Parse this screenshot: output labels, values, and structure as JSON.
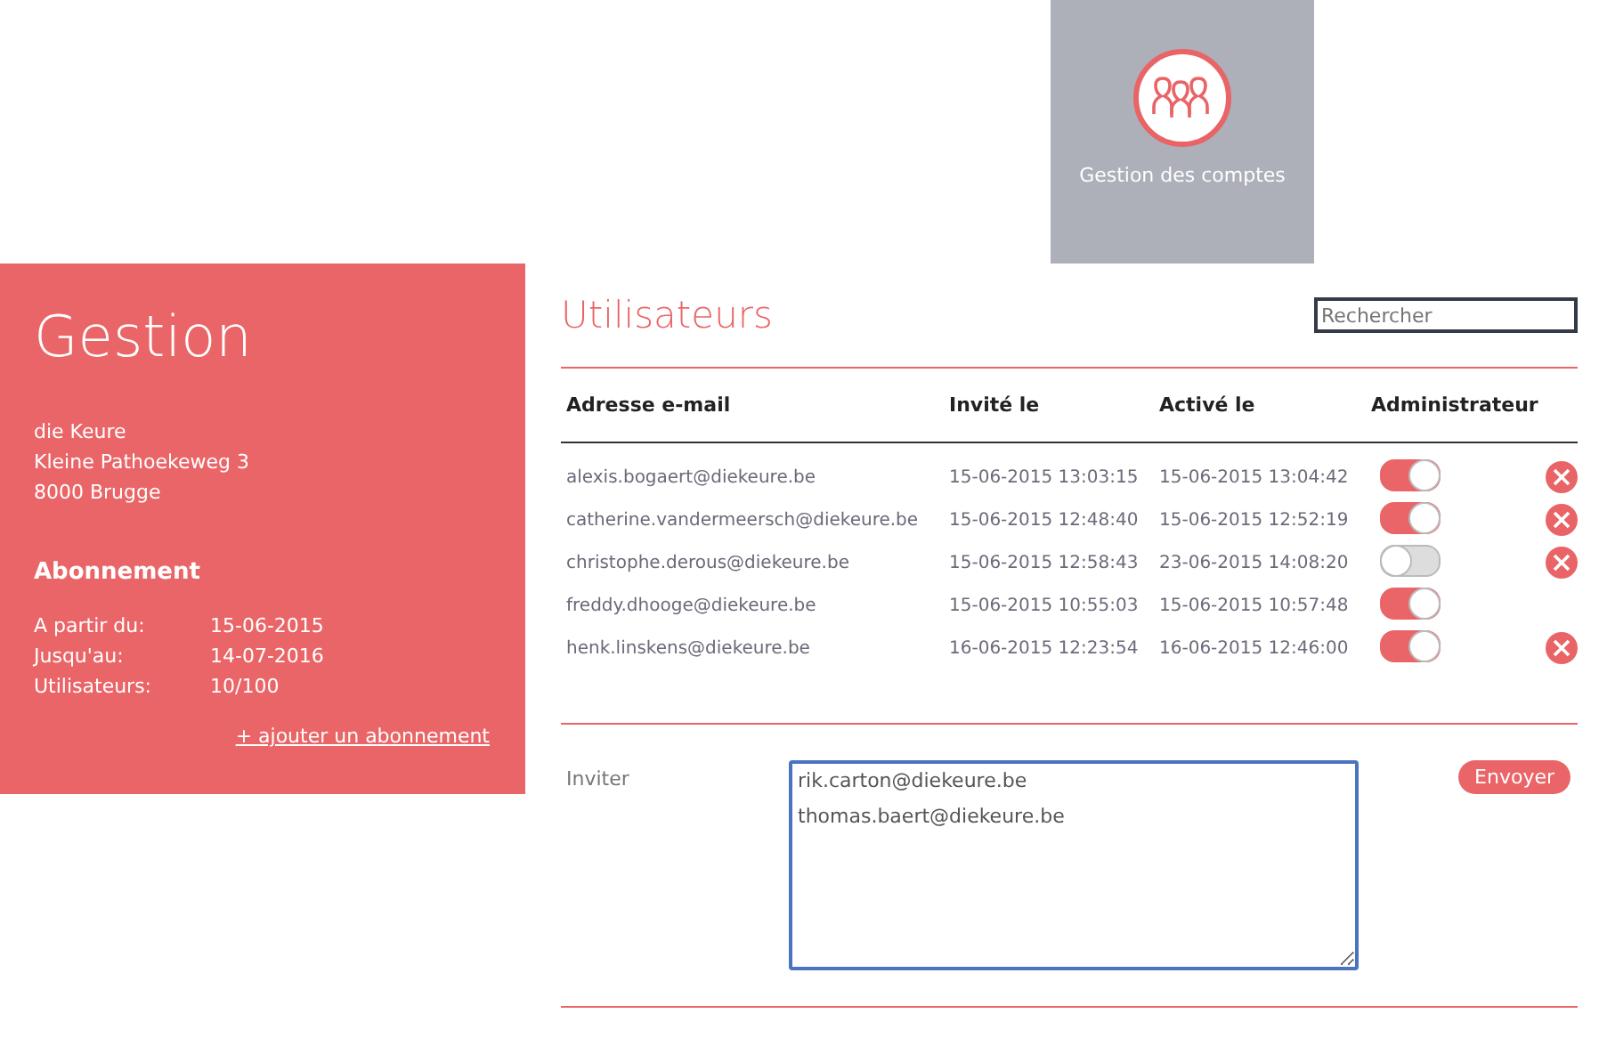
{
  "tile": {
    "label": "Gestion des comptes"
  },
  "sidebar": {
    "title": "Gestion",
    "address": [
      "die Keure",
      "Kleine Pathoekeweg 3",
      "8000 Brugge"
    ],
    "subscription_title": "Abonnement",
    "subscription": [
      {
        "label": "A partir du:",
        "value": "15-06-2015"
      },
      {
        "label": "Jusqu'au:",
        "value": "14-07-2016"
      },
      {
        "label": "Utilisateurs:",
        "value": "10/100"
      }
    ],
    "add_link": "+ ajouter un abonnement"
  },
  "users": {
    "title": "Utilisateurs",
    "search": {
      "placeholder": "Rechercher"
    },
    "columns": [
      "Adresse e-mail",
      "Invité le",
      "Activé le",
      "Administrateur"
    ],
    "rows": [
      {
        "email": "alexis.bogaert@diekeure.be",
        "invited": "15-06-2015 13:03:15",
        "activated": "15-06-2015 13:04:42",
        "admin": true,
        "deletable": true
      },
      {
        "email": "catherine.vandermeersch@diekeure.be",
        "invited": "15-06-2015 12:48:40",
        "activated": "15-06-2015 12:52:19",
        "admin": true,
        "deletable": true
      },
      {
        "email": "christophe.derous@diekeure.be",
        "invited": "15-06-2015 12:58:43",
        "activated": "23-06-2015 14:08:20",
        "admin": false,
        "deletable": true
      },
      {
        "email": "freddy.dhooge@diekeure.be",
        "invited": "15-06-2015 10:55:03",
        "activated": "15-06-2015 10:57:48",
        "admin": true,
        "deletable": false
      },
      {
        "email": "henk.linskens@diekeure.be",
        "invited": "16-06-2015 12:23:54",
        "activated": "16-06-2015 12:46:00",
        "admin": true,
        "deletable": true
      }
    ]
  },
  "invite": {
    "label": "Inviter",
    "value": "rik.carton@diekeure.be\nthomas.baert@diekeure.be",
    "button": "Envoyer"
  }
}
